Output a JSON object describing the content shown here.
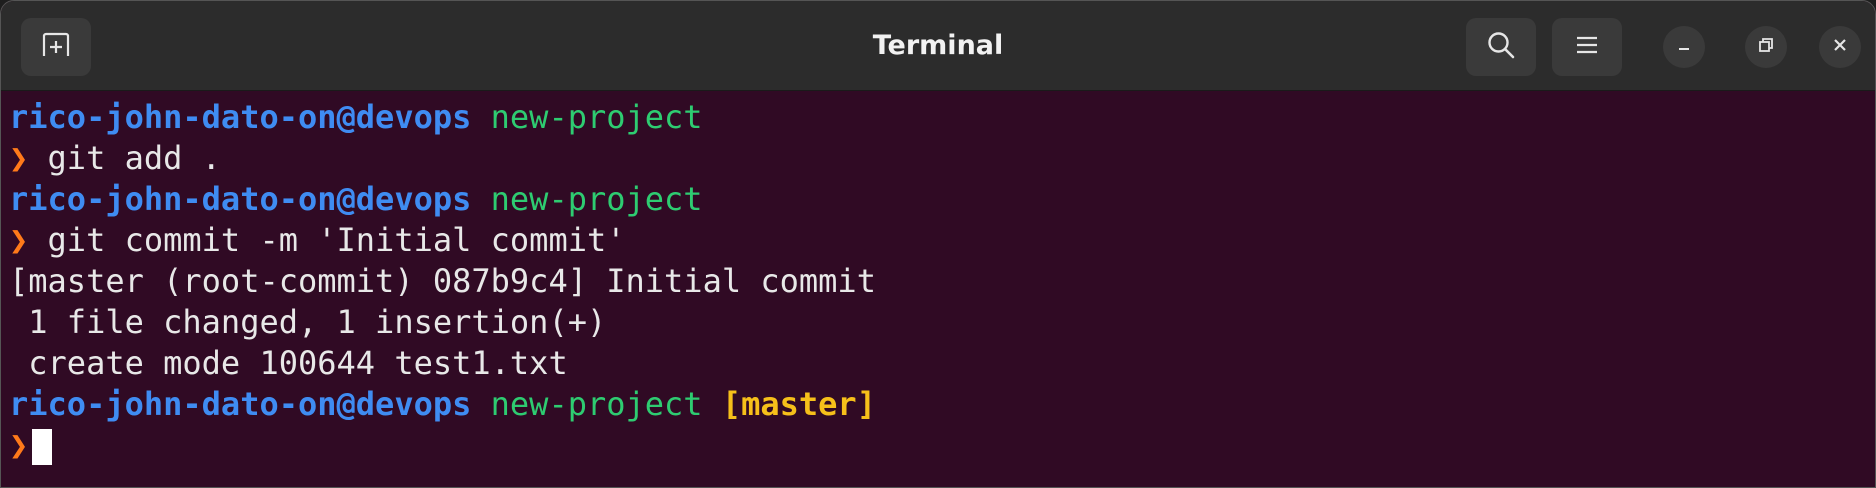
{
  "window": {
    "title": "Terminal"
  },
  "icons": {
    "new_tab": "new-tab-icon",
    "search": "search-icon",
    "menu": "hamburger-menu-icon",
    "minimize": "minimize-icon",
    "maximize": "maximize-icon",
    "close": "close-icon"
  },
  "colors": {
    "background": "#300a24",
    "user": "#3f8cf2",
    "directory": "#2ecc71",
    "branch": "#f6c01a",
    "prompt_arrow": "#ff7a1a",
    "output": "#e8e8e8"
  },
  "terminal": {
    "prompt_symbol": "❯",
    "lines": [
      {
        "type": "prompt",
        "user": "rico-john-dato-on@devops",
        "dir": "new-project",
        "branch": ""
      },
      {
        "type": "command",
        "text": "git add ."
      },
      {
        "type": "prompt",
        "user": "rico-john-dato-on@devops",
        "dir": "new-project",
        "branch": ""
      },
      {
        "type": "command",
        "text": "git commit -m 'Initial commit'"
      },
      {
        "type": "output",
        "text": "[master (root-commit) 087b9c4] Initial commit"
      },
      {
        "type": "output",
        "text": " 1 file changed, 1 insertion(+)"
      },
      {
        "type": "output",
        "text": " create mode 100644 test1.txt"
      },
      {
        "type": "prompt",
        "user": "rico-john-dato-on@devops",
        "dir": "new-project",
        "branch": "[master]"
      },
      {
        "type": "command",
        "text": ""
      }
    ]
  }
}
